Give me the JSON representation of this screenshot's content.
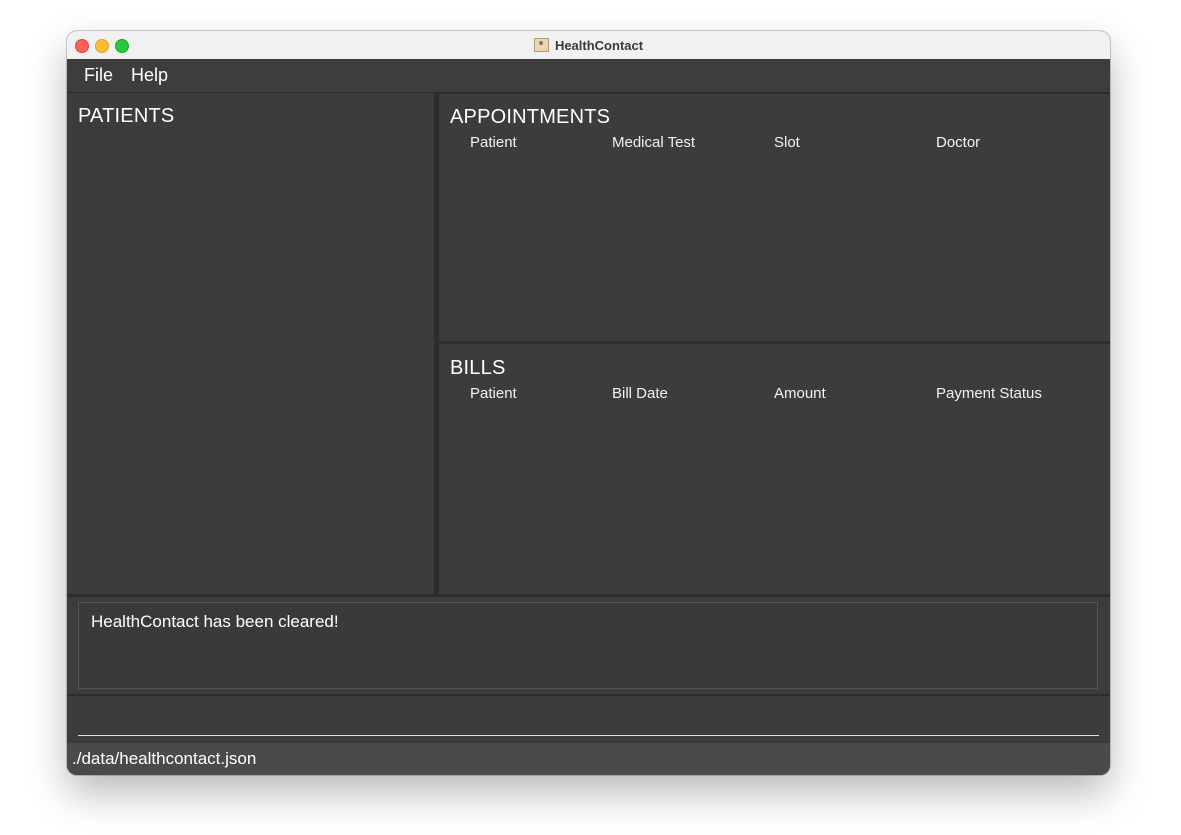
{
  "window": {
    "title": "HealthContact",
    "app_icon": "contact-book-icon"
  },
  "menu": {
    "items": [
      {
        "label": "File"
      },
      {
        "label": "Help"
      }
    ]
  },
  "patients": {
    "title": "PATIENTS",
    "items": []
  },
  "appointments": {
    "title": "APPOINTMENTS",
    "columns": [
      "Patient",
      "Medical Test",
      "Slot",
      "Doctor"
    ],
    "rows": []
  },
  "bills": {
    "title": "BILLS",
    "columns": [
      "Patient",
      "Bill Date",
      "Amount",
      "Payment Status"
    ],
    "rows": []
  },
  "result": {
    "message": "HealthContact has been cleared!"
  },
  "command": {
    "value": "",
    "placeholder": ""
  },
  "status": {
    "path": "./data/healthcontact.json"
  },
  "colors": {
    "background": "#3c3c3c",
    "text": "#ffffff",
    "status_bar": "#4a4a4a",
    "title_bar": "#f1f1f1"
  }
}
